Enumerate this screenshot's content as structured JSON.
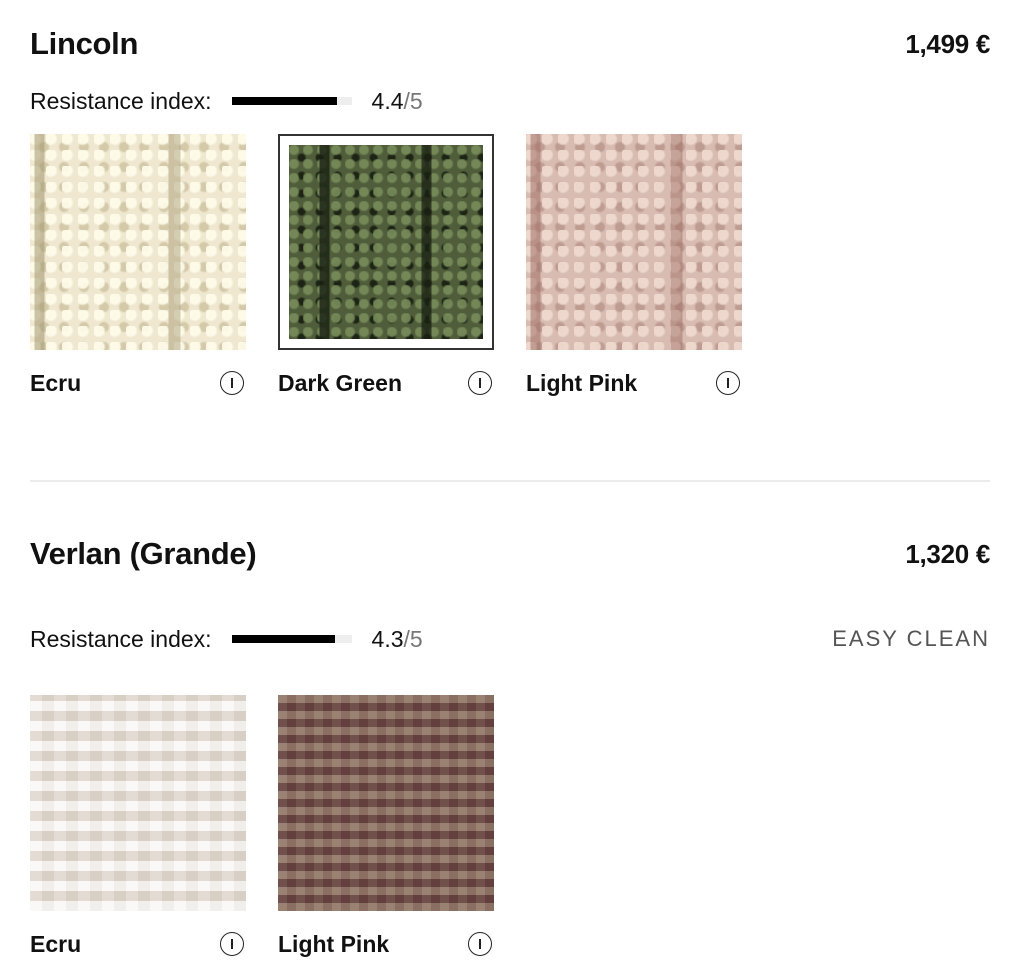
{
  "fabrics": [
    {
      "name": "Lincoln",
      "price": "1,499 €",
      "resistance_label": "Resistance index:",
      "resistance_score": "4.4",
      "resistance_max": "/5",
      "resistance_fraction": 0.88,
      "badge": "",
      "swatches": [
        {
          "name": "Ecru",
          "selected": false,
          "icon": "info-icon"
        },
        {
          "name": "Dark Green",
          "selected": true,
          "icon": "info-icon"
        },
        {
          "name": "Light Pink",
          "selected": false,
          "icon": "info-icon"
        }
      ]
    },
    {
      "name": "Verlan (Grande)",
      "price": "1,320 €",
      "resistance_label": "Resistance index:",
      "resistance_score": "4.3",
      "resistance_max": "/5",
      "resistance_fraction": 0.86,
      "badge": "EASY CLEAN",
      "swatches": [
        {
          "name": "Ecru",
          "selected": false,
          "icon": "info-icon"
        },
        {
          "name": "Light Pink",
          "selected": false,
          "icon": "info-icon"
        }
      ]
    }
  ],
  "colors": {
    "bar_fill": "#000000",
    "bar_track": "#eeeeee",
    "divider": "#ececec"
  }
}
